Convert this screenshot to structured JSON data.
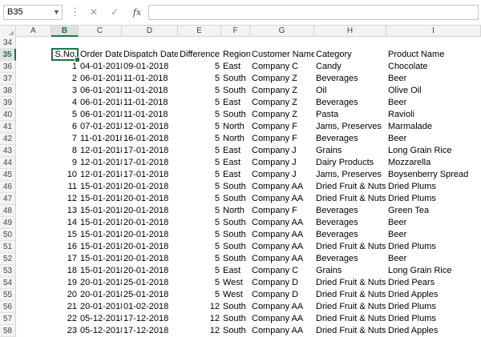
{
  "formula_bar": {
    "name_box": "B35",
    "cancel_icon": "✕",
    "enter_icon": "✓",
    "fx_label": "fx",
    "formula": ""
  },
  "columns": [
    {
      "letter": "A",
      "key": "a"
    },
    {
      "letter": "B",
      "key": "sno"
    },
    {
      "letter": "C",
      "key": "order_date"
    },
    {
      "letter": "D",
      "key": "dispatch_date"
    },
    {
      "letter": "E",
      "key": "difference"
    },
    {
      "letter": "F",
      "key": "region"
    },
    {
      "letter": "G",
      "key": "customer"
    },
    {
      "letter": "H",
      "key": "category"
    },
    {
      "letter": "I",
      "key": "product"
    }
  ],
  "active_column": "B",
  "active_row": "35",
  "rows": [
    {
      "num": "34",
      "a": "",
      "sno": "",
      "order_date": "",
      "dispatch_date": "",
      "difference": "",
      "region": "",
      "customer": "",
      "category": "",
      "product": ""
    },
    {
      "num": "35",
      "a": "",
      "sno": "S.No.",
      "order_date": "Order Date",
      "dispatch_date": "Dispatch Date",
      "difference": "Difference",
      "region": "Region",
      "customer": "Customer Name",
      "category": "Category",
      "product": "Product Name"
    },
    {
      "num": "36",
      "a": "",
      "sno": "1",
      "order_date": "04-01-2018",
      "dispatch_date": "09-01-2018",
      "difference": "5",
      "region": "East",
      "customer": "Company C",
      "category": "Candy",
      "product": "Chocolate"
    },
    {
      "num": "37",
      "a": "",
      "sno": "2",
      "order_date": "06-01-2018",
      "dispatch_date": "11-01-2018",
      "difference": "5",
      "region": "South",
      "customer": "Company Z",
      "category": "Beverages",
      "product": "Beer"
    },
    {
      "num": "38",
      "a": "",
      "sno": "3",
      "order_date": "06-01-2018",
      "dispatch_date": "11-01-2018",
      "difference": "5",
      "region": "South",
      "customer": "Company Z",
      "category": "Oil",
      "product": "Olive Oil"
    },
    {
      "num": "39",
      "a": "",
      "sno": "4",
      "order_date": "06-01-2018",
      "dispatch_date": "11-01-2018",
      "difference": "5",
      "region": "East",
      "customer": "Company Z",
      "category": "Beverages",
      "product": "Beer"
    },
    {
      "num": "40",
      "a": "",
      "sno": "5",
      "order_date": "06-01-2018",
      "dispatch_date": "11-01-2018",
      "difference": "5",
      "region": "South",
      "customer": "Company Z",
      "category": "Pasta",
      "product": "Ravioli"
    },
    {
      "num": "41",
      "a": "",
      "sno": "6",
      "order_date": "07-01-2018",
      "dispatch_date": "12-01-2018",
      "difference": "5",
      "region": "North",
      "customer": "Company F",
      "category": "Jams, Preserves",
      "product": "Marmalade"
    },
    {
      "num": "42",
      "a": "",
      "sno": "7",
      "order_date": "11-01-2018",
      "dispatch_date": "16-01-2018",
      "difference": "5",
      "region": "North",
      "customer": "Company F",
      "category": "Beverages",
      "product": "Beer"
    },
    {
      "num": "43",
      "a": "",
      "sno": "8",
      "order_date": "12-01-2018",
      "dispatch_date": "17-01-2018",
      "difference": "5",
      "region": "East",
      "customer": "Company J",
      "category": "Grains",
      "product": "Long Grain Rice"
    },
    {
      "num": "44",
      "a": "",
      "sno": "9",
      "order_date": "12-01-2018",
      "dispatch_date": "17-01-2018",
      "difference": "5",
      "region": "East",
      "customer": "Company J",
      "category": "Dairy Products",
      "product": "Mozzarella"
    },
    {
      "num": "45",
      "a": "",
      "sno": "10",
      "order_date": "12-01-2018",
      "dispatch_date": "17-01-2018",
      "difference": "5",
      "region": "East",
      "customer": "Company J",
      "category": "Jams, Preserves",
      "product": "Boysenberry Spread"
    },
    {
      "num": "46",
      "a": "",
      "sno": "11",
      "order_date": "15-01-2018",
      "dispatch_date": "20-01-2018",
      "difference": "5",
      "region": "South",
      "customer": "Company AA",
      "category": "Dried Fruit & Nuts",
      "product": "Dried Plums"
    },
    {
      "num": "47",
      "a": "",
      "sno": "12",
      "order_date": "15-01-2018",
      "dispatch_date": "20-01-2018",
      "difference": "5",
      "region": "South",
      "customer": "Company AA",
      "category": "Dried Fruit & Nuts",
      "product": "Dried Plums"
    },
    {
      "num": "48",
      "a": "",
      "sno": "13",
      "order_date": "15-01-2018",
      "dispatch_date": "20-01-2018",
      "difference": "5",
      "region": "North",
      "customer": "Company F",
      "category": "Beverages",
      "product": "Green Tea"
    },
    {
      "num": "49",
      "a": "",
      "sno": "14",
      "order_date": "15-01-2018",
      "dispatch_date": "20-01-2018",
      "difference": "5",
      "region": "South",
      "customer": "Company AA",
      "category": "Beverages",
      "product": "Beer"
    },
    {
      "num": "50",
      "a": "",
      "sno": "15",
      "order_date": "15-01-2018",
      "dispatch_date": "20-01-2018",
      "difference": "5",
      "region": "South",
      "customer": "Company AA",
      "category": "Beverages",
      "product": "Beer"
    },
    {
      "num": "51",
      "a": "",
      "sno": "16",
      "order_date": "15-01-2018",
      "dispatch_date": "20-01-2018",
      "difference": "5",
      "region": "South",
      "customer": "Company AA",
      "category": "Dried Fruit & Nuts",
      "product": "Dried Plums"
    },
    {
      "num": "52",
      "a": "",
      "sno": "17",
      "order_date": "15-01-2018",
      "dispatch_date": "20-01-2018",
      "difference": "5",
      "region": "South",
      "customer": "Company AA",
      "category": "Beverages",
      "product": "Beer"
    },
    {
      "num": "53",
      "a": "",
      "sno": "18",
      "order_date": "15-01-2018",
      "dispatch_date": "20-01-2018",
      "difference": "5",
      "region": "East",
      "customer": "Company C",
      "category": "Grains",
      "product": "Long Grain Rice"
    },
    {
      "num": "54",
      "a": "",
      "sno": "19",
      "order_date": "20-01-2018",
      "dispatch_date": "25-01-2018",
      "difference": "5",
      "region": "West",
      "customer": "Company D",
      "category": "Dried Fruit & Nuts",
      "product": "Dried Pears"
    },
    {
      "num": "55",
      "a": "",
      "sno": "20",
      "order_date": "20-01-2018",
      "dispatch_date": "25-01-2018",
      "difference": "5",
      "region": "West",
      "customer": "Company D",
      "category": "Dried Fruit & Nuts",
      "product": "Dried Apples"
    },
    {
      "num": "56",
      "a": "",
      "sno": "21",
      "order_date": "20-01-2018",
      "dispatch_date": "01-02-2018",
      "difference": "12",
      "region": "South",
      "customer": "Company AA",
      "category": "Dried Fruit & Nuts",
      "product": "Dried Plums"
    },
    {
      "num": "57",
      "a": "",
      "sno": "22",
      "order_date": "05-12-2018",
      "dispatch_date": "17-12-2018",
      "difference": "12",
      "region": "South",
      "customer": "Company AA",
      "category": "Dried Fruit & Nuts",
      "product": "Dried Plums"
    },
    {
      "num": "58",
      "a": "",
      "sno": "23",
      "order_date": "05-12-2018",
      "dispatch_date": "17-12-2018",
      "difference": "12",
      "region": "South",
      "customer": "Company AA",
      "category": "Dried Fruit & Nuts",
      "product": "Dried Apples"
    }
  ]
}
